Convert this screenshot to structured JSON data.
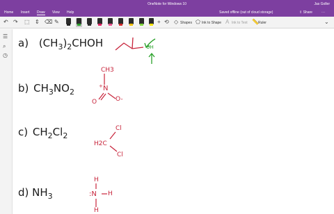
{
  "app": {
    "title": "OneNote for Windows 10",
    "user": "Jas Goller"
  },
  "menu": {
    "tabs": [
      "Home",
      "Insert",
      "Draw",
      "View",
      "Help"
    ],
    "active": "Draw"
  },
  "toolbar": {
    "save_status": "Saved offline (out of cloud storage)",
    "share_label": "Share",
    "shapes_label": "Shapes",
    "ink_to_shape_label": "Ink to Shape",
    "ink_to_text_label": "Ink to Text",
    "ruler_label": "Ruler",
    "pen_colors": [
      "#222222",
      "#2aa12a",
      "#2b2b2b",
      "#e02060",
      "#e8508a",
      "#d42a2a",
      "#f0c000",
      "#7fd63a",
      "#f5e400"
    ],
    "selected_pen": 1
  },
  "notes": {
    "a": {
      "label": "a)",
      "formula": "(CH",
      "sub1": "3",
      "paren": ")",
      "sub2": "2",
      "rest": "CHOH"
    },
    "b": {
      "label": "b)",
      "formula": "CH",
      "sub1": "3",
      "mid": "NO",
      "sub2": "2"
    },
    "c": {
      "label": "c)",
      "formula": "CH",
      "sub1": "2",
      "mid": "Cl",
      "sub2": "2"
    },
    "d": {
      "label": "d)",
      "formula": "NH",
      "sub1": "3"
    }
  },
  "structures": {
    "a_oh": "OH",
    "b_ch3": "CH3",
    "b_n": "N",
    "b_plus": "+",
    "b_o": "O",
    "b_o_minus": "O-",
    "c_h2c": "H2C",
    "c_cl_top": "Cl",
    "c_cl_bottom": "Cl",
    "d_h_top": "H",
    "d_n": ":N",
    "d_h_right": "H",
    "d_h_bottom": "H"
  }
}
